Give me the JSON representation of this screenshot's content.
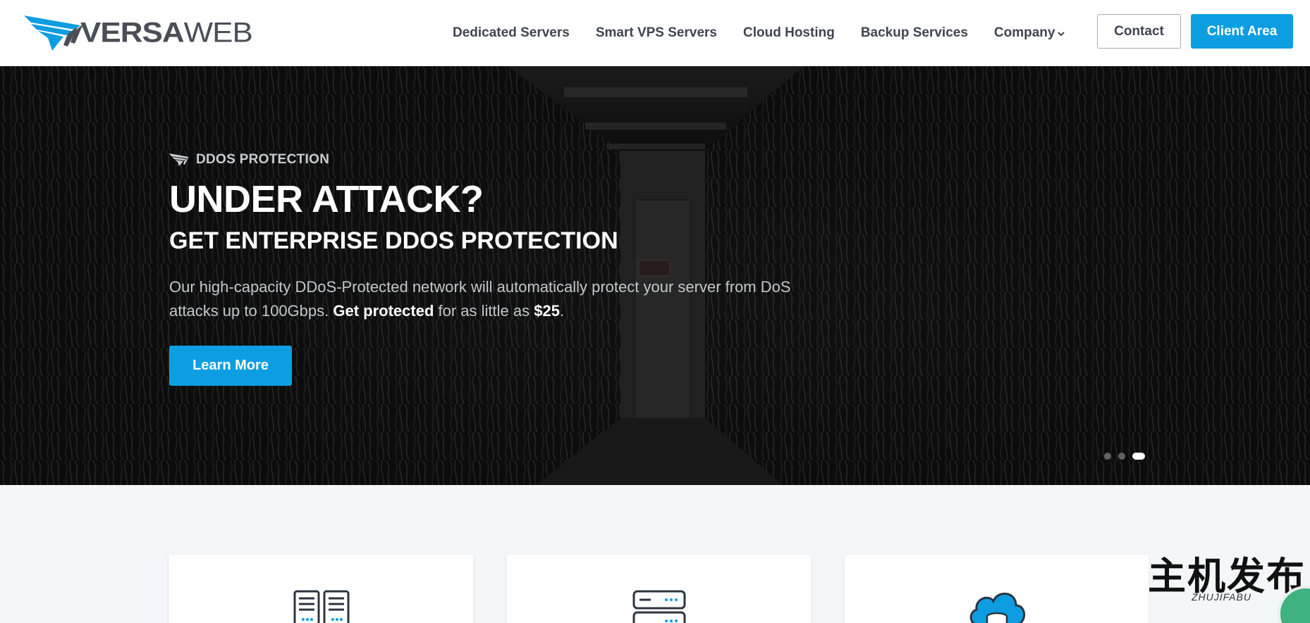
{
  "brand": {
    "name_bold": "VERSA",
    "name_light": "WEB",
    "accent": "#0d9ee2"
  },
  "nav": {
    "items": [
      {
        "label": "Dedicated Servers"
      },
      {
        "label": "Smart VPS Servers"
      },
      {
        "label": "Cloud Hosting"
      },
      {
        "label": "Backup Services"
      },
      {
        "label": "Company",
        "has_dropdown": true
      }
    ],
    "contact_label": "Contact",
    "client_area_label": "Client Area"
  },
  "hero": {
    "eyebrow": "DDOS PROTECTION",
    "title": "UNDER ATTACK?",
    "subtitle": "GET ENTERPRISE DDOS PROTECTION",
    "desc_part1": "Our high-capacity DDoS-Protected network will automatically protect your server from DoS attacks up to 100Gbps. ",
    "desc_bold1": "Get protected",
    "desc_part2": " for as little as ",
    "desc_bold2": "$25",
    "desc_part3": ".",
    "cta_label": "Learn More",
    "slides_total": 3,
    "active_slide": 3
  },
  "cards": [
    {
      "icon": "dedicated-servers-icon"
    },
    {
      "icon": "vps-server-icon"
    },
    {
      "icon": "cloud-hosting-icon"
    }
  ],
  "watermark": {
    "big": "主机发布",
    "small": "ZHUJIFABU"
  }
}
